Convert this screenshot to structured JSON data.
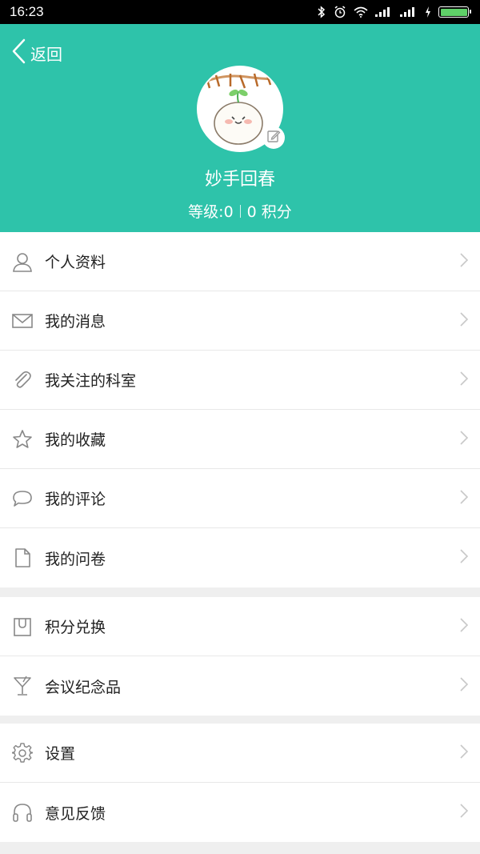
{
  "status_bar": {
    "time": "16:23"
  },
  "header": {
    "back_label": "返回",
    "username": "妙手回春",
    "level_text": "等级:0",
    "points_text": "0 积分",
    "bg_color": "#2ec3aa"
  },
  "menu": {
    "group1": [
      {
        "label": "个人资料",
        "icon": "person-icon"
      },
      {
        "label": "我的消息",
        "icon": "envelope-icon"
      },
      {
        "label": "我关注的科室",
        "icon": "paperclip-icon"
      },
      {
        "label": "我的收藏",
        "icon": "star-icon"
      },
      {
        "label": "我的评论",
        "icon": "speech-bubble-icon"
      },
      {
        "label": "我的问卷",
        "icon": "document-icon"
      }
    ],
    "group2": [
      {
        "label": "积分兑换",
        "icon": "shopping-bag-icon"
      },
      {
        "label": "会议纪念品",
        "icon": "cocktail-glass-icon"
      }
    ],
    "group3": [
      {
        "label": "设置",
        "icon": "gear-icon"
      },
      {
        "label": "意见反馈",
        "icon": "headphones-icon"
      }
    ]
  }
}
